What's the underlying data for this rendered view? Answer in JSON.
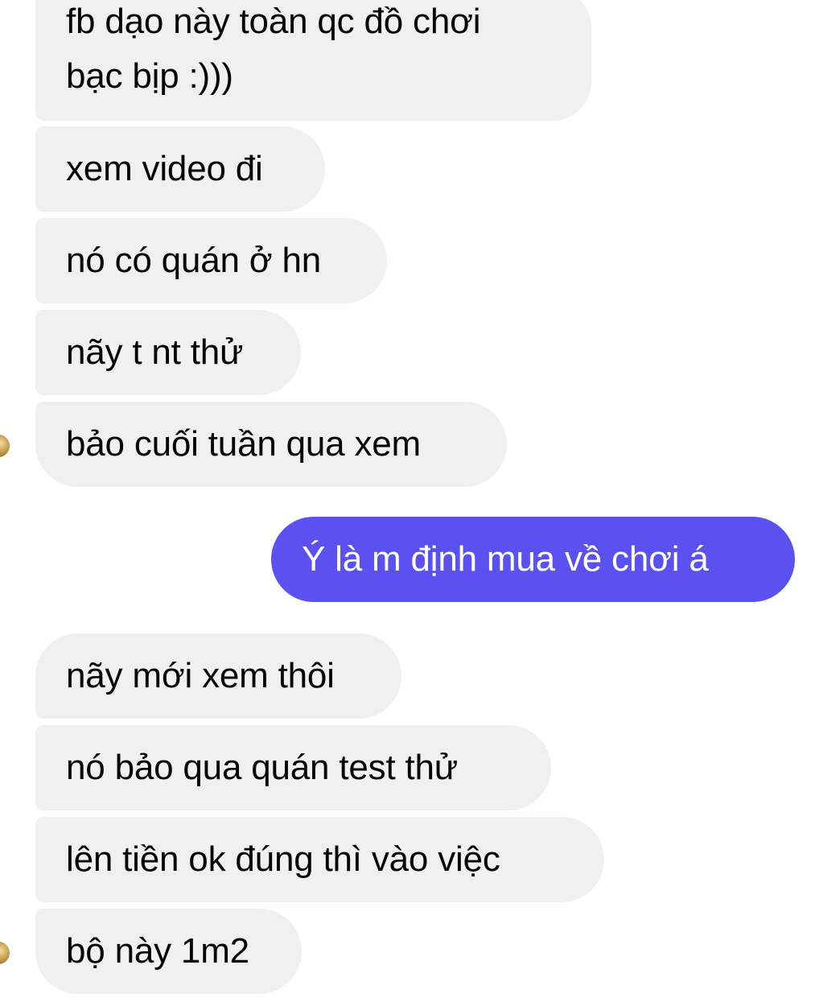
{
  "conversation": {
    "messages": [
      {
        "id": "m1",
        "side": "incoming",
        "lines": [
          "fb dạo này toàn qc đồ chơi",
          "bạc bịp :)))"
        ]
      },
      {
        "id": "m2",
        "side": "incoming",
        "text": "xem video đi"
      },
      {
        "id": "m3",
        "side": "incoming",
        "text": "nó có quán ở hn"
      },
      {
        "id": "m4",
        "side": "incoming",
        "text": "nãy t nt thử"
      },
      {
        "id": "m5",
        "side": "incoming",
        "text": "bảo cuối tuần qua xem"
      },
      {
        "id": "m6",
        "side": "outgoing",
        "text": "Ý là m định mua về chơi á"
      },
      {
        "id": "m7",
        "side": "incoming",
        "text": "nãy mới xem thôi"
      },
      {
        "id": "m8",
        "side": "incoming",
        "text": "nó bảo qua quán test thử"
      },
      {
        "id": "m9",
        "side": "incoming",
        "text": "lên tiền ok đúng thì vào việc"
      },
      {
        "id": "m10",
        "side": "incoming",
        "text": "bộ này 1m2"
      }
    ]
  },
  "colors": {
    "incoming_bubble": "#f0f0f0",
    "outgoing_bubble": "#5b51f0",
    "incoming_text": "#050505",
    "outgoing_text": "#ffffff"
  }
}
